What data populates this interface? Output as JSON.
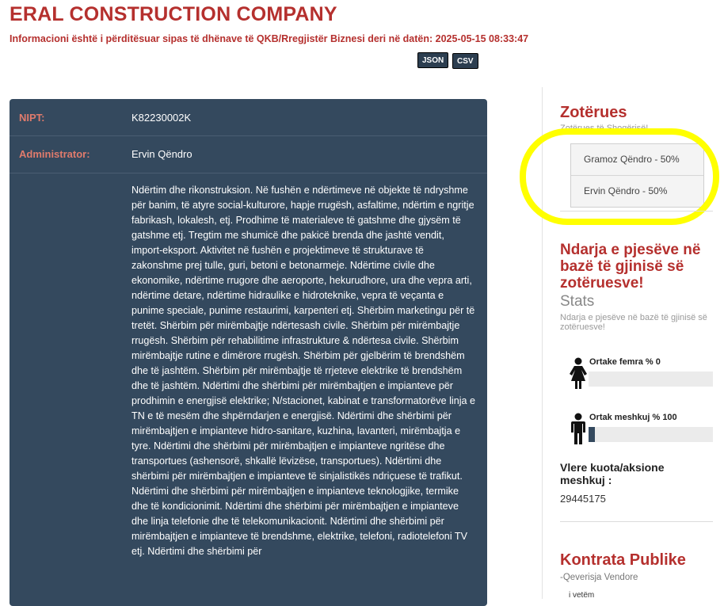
{
  "company": {
    "name": "ERAL CONSTRUCTION COMPANY",
    "updated_notice": "Informacioni është i përditësuar sipas të dhënave të QKB/Rregjistër Biznesi deri në datën: 2025-05-15 08:33:47"
  },
  "downloads": {
    "json_label": "JSON",
    "csv_label": "CSV"
  },
  "details": {
    "nipt_label": "NIPT:",
    "nipt_value": "K82230002K",
    "admin_label": "Administrator:",
    "admin_value": "Ervin Qëndro",
    "description": "Ndërtim dhe rikonstruksion. Në fushën e ndërtimeve në objekte të ndryshme për banim, të atyre social-kulturore, hapje rrugësh, asfaltime, ndërtim e ngritje fabrikash, lokalesh, etj. Prodhime të materialeve të gatshme dhe gjysëm të gatshme etj. Tregtim me shumicë dhe pakicë brenda dhe jashtë vendit, import-eksport. Aktivitet në fushën e projektimeve të strukturave të zakonshme prej tulle, guri, betoni e betonarmeje. Ndërtime civile dhe ekonomike, ndërtime rrugore dhe aeroporte, hekurudhore, ura dhe vepra arti, ndërtime detare, ndërtime hidraulike e hidroteknike, vepra të veçanta e punime speciale, punime restaurimi, karpenteri etj. Shërbim marketingu për të tretët. Shërbim për mirëmbajtje ndërtesash civile. Shërbim për mirëmbajtje rrugësh. Shërbim për rehabilitime infrastrukture & ndërtesa civile. Shërbim mirëmbajtje rutine e dimërore rrugësh. Shërbim për gjelbërim të brendshëm dhe të jashtëm. Shërbim për mirëmbajtje të rrjeteve elektrike të brendshëm dhe të jashtëm. Ndërtimi dhe shërbimi për mirëmbajtjen e impianteve për prodhimin e energjisë elektrike; N/stacionet, kabinat e transformatorëve linja e TN e të mesëm dhe shpërndarjen e energjisë. Ndërtimi dhe shërbimi për mirëmbajtjen e impianteve hidro-sanitare, kuzhina, lavanteri, mirëmbajtja e tyre. Ndërtimi dhe shërbimi për mirëmbajtjen e impianteve ngritëse dhe transportues (ashensorë, shkallë lëvizëse, transportues). Ndërtimi dhe shërbimi për mirëmbajtjen e impianteve të sinjalistikës ndriçuese të trafikut. Ndërtimi dhe shërbimi për mirëmbajtjen e impianteve teknologjike, termike dhe të kondicionimit. Ndërtimi dhe shërbimi për mirëmbajtjen e impianteve dhe linja telefonie dhe të telekomunikacionit. Ndërtimi dhe shërbimi për mirëmbajtjen e impianteve të brendshme, elektrike, telefoni, radiotelefoni TV etj. Ndërtimi dhe shërbimi për"
  },
  "owners": {
    "title": "Zotërues",
    "subtitle": "Zotërues të Shoqërisë!",
    "items": [
      {
        "label": "Gramoz Qëndro - 50%"
      },
      {
        "label": "Ervin Qëndro - 50%"
      }
    ]
  },
  "gender": {
    "title": "Ndarja e pjesëve në bazë të gjinisë së zotëruesve!",
    "stats_title": "Stats",
    "stats_subtitle": "Ndarja e pjesëve në bazë të gjinisë së zotëruesve!",
    "female_label": "Ortake femra % 0",
    "female_pct": 0,
    "male_label": "Ortak meshkuj % 100",
    "male_pct": 5,
    "kuota_label": "Vlere kuota/aksione meshkuj :",
    "kuota_value": "29445175"
  },
  "contracts": {
    "title": "Kontrata Publike",
    "subtitle": "-Qeverisja Vendore",
    "note": "i vetëm"
  },
  "colors": {
    "accent": "#b5302e",
    "panel": "#34495e",
    "highlight": "#ffff00"
  }
}
